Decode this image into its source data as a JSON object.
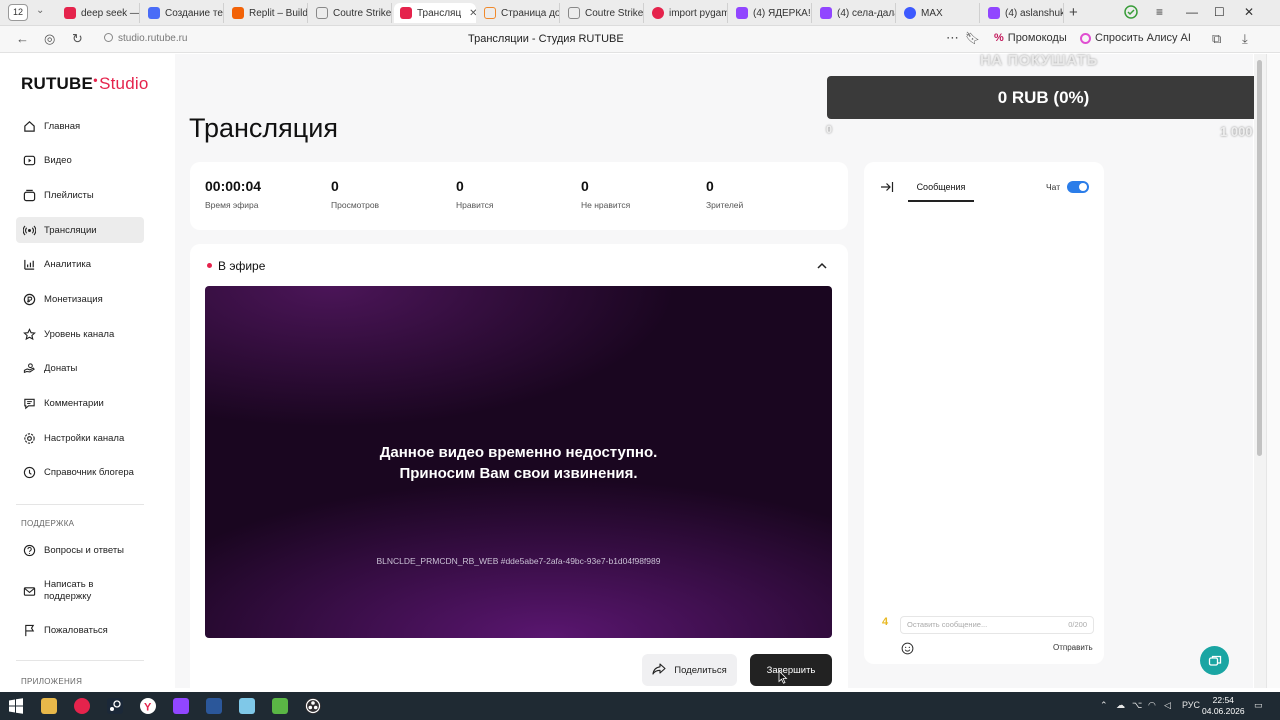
{
  "browser": {
    "tab_count": "12",
    "tabs": [
      {
        "label": "deep seek —",
        "color": "#e5234c"
      },
      {
        "label": "Создание те",
        "color": "#4a6cf7"
      },
      {
        "label": "Replit – Build",
        "color": "#f26207"
      },
      {
        "label": "Coutre Strike",
        "color": "#888888"
      },
      {
        "label": "Трансляц",
        "color": "#e5234c",
        "active": true
      },
      {
        "label": "Страница до",
        "color": "#f0892b"
      },
      {
        "label": "Coutre Strike",
        "color": "#888888"
      },
      {
        "label": "import pygam",
        "color": "#e5234c"
      },
      {
        "label": "(4) ЯДЕРКА!",
        "color": "#9146ff"
      },
      {
        "label": "(4) села-дала",
        "color": "#9146ff"
      },
      {
        "label": "MAX",
        "color": "#3d5afe"
      },
      {
        "label": "(4) aslanshuk",
        "color": "#9146ff"
      }
    ],
    "url": "studio.rutube.ru",
    "page_title": "Трансляции - Студия RUTUBE",
    "promo_label": "Промокоды",
    "alice_label": "Спросить Алису AI"
  },
  "sidebar": {
    "logo_main": "RUTUBE",
    "logo_studio": "Studio",
    "items": [
      {
        "label": "Главная",
        "icon": "home-icon"
      },
      {
        "label": "Видео",
        "icon": "video-icon"
      },
      {
        "label": "Плейлисты",
        "icon": "playlist-icon"
      },
      {
        "label": "Трансляции",
        "icon": "broadcast-icon",
        "active": true
      },
      {
        "label": "Аналитика",
        "icon": "analytics-icon"
      },
      {
        "label": "Монетизация",
        "icon": "monetization-icon"
      },
      {
        "label": "Уровень канала",
        "icon": "star-icon"
      },
      {
        "label": "Донаты",
        "icon": "donate-icon"
      },
      {
        "label": "Комментарии",
        "icon": "comments-icon"
      },
      {
        "label": "Настройки канала",
        "icon": "settings-icon"
      },
      {
        "label": "Справочник блогера",
        "icon": "guide-icon"
      }
    ],
    "support_section": "ПОДДЕРЖКА",
    "support_items": [
      {
        "label": "Вопросы и ответы",
        "icon": "faq-icon"
      },
      {
        "label": "Написать в поддержку",
        "icon": "mail-icon"
      },
      {
        "label": "Пожаловаться",
        "icon": "flag-icon"
      }
    ],
    "apps_section": "ПРИЛОЖЕНИЯ"
  },
  "main": {
    "heading": "Трансляция",
    "stats": [
      {
        "value": "00:00:04",
        "label": "Время эфира"
      },
      {
        "value": "0",
        "label": "Просмотров"
      },
      {
        "value": "0",
        "label": "Нравится"
      },
      {
        "value": "0",
        "label": "Не нравится"
      },
      {
        "value": "0",
        "label": "Зрителей"
      }
    ],
    "live_label": "В эфире",
    "player_msg_1": "Данное видео временно недоступно.",
    "player_msg_2": "Приносим Вам свои извинения.",
    "player_code": "BLNCLDE_PRMCDN_RB_WEB #dde5abe7-2afa-49bc-93e7-b1d04f98f989",
    "share_label": "Поделиться",
    "end_label": "Завершить"
  },
  "chat": {
    "tab_label": "Сообщения",
    "chat_toggle_label": "Чат",
    "chat_enabled": true,
    "input_placeholder": "Оставить сообщение...",
    "char_count": "0/200",
    "coin_value": "4",
    "send_label": "Отправить"
  },
  "overlay": {
    "title": "НА ПОКУШАТЬ",
    "progress_text": "0 RUB (0%)",
    "progress_fraction": 0,
    "min": "0",
    "max": "1 000"
  },
  "taskbar": {
    "lang": "РУС",
    "time": "22:54",
    "date": "04.06.2026"
  }
}
